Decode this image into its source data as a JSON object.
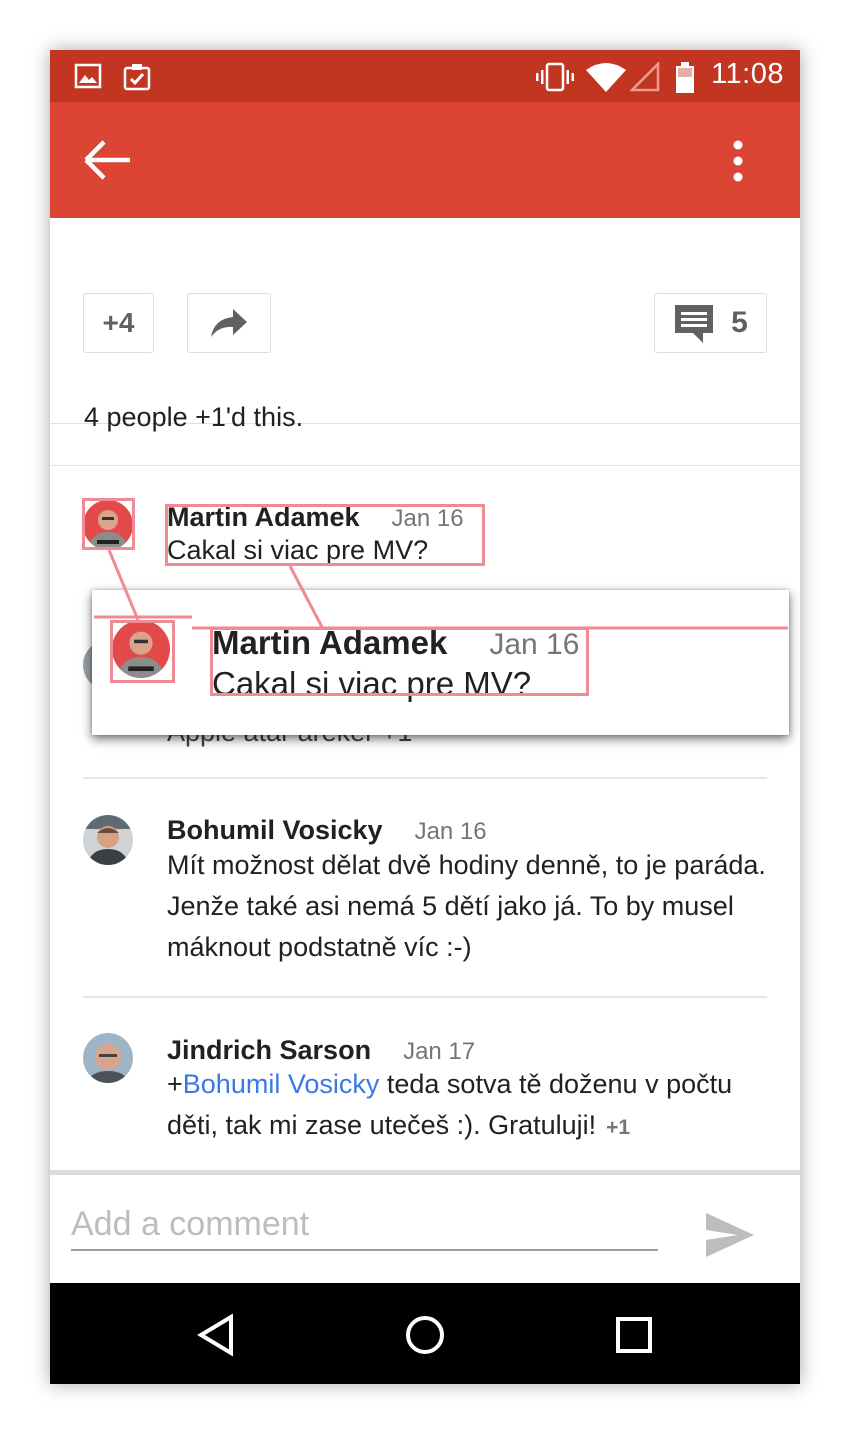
{
  "status_bar": {
    "time": "11:08",
    "icons": [
      "image-icon",
      "clipboard-check-icon",
      "vibrate-icon",
      "wifi-icon",
      "signal-icon",
      "battery-icon"
    ]
  },
  "app_bar": {
    "background": "#dc4533",
    "status_background": "#c23520"
  },
  "actions": {
    "plus_count": "+4",
    "comment_count": "5"
  },
  "plus_summary": "4 people +1'd this.",
  "comments": [
    {
      "author": "Martin Adamek",
      "date": "Jan 16",
      "text": "Cakal si viac pre MV?"
    },
    {
      "author": "Bohumil Vosicky",
      "date": "Jan 16",
      "text": "Mít možnost dělat dvě hodiny denně, to je paráda. Jenže také asi nemá 5 dětí jako já. To by musel máknout podstatně víc :-)"
    },
    {
      "author": "Jindrich Sarson",
      "date": "Jan 17",
      "mention_prefix": "+",
      "mention": "Bohumil Vosicky",
      "text": " teda sotva tě doženu v počtu děti, tak mi zase utečeš :). Gratuluji!",
      "plus_one": "+1"
    }
  ],
  "hidden_comment_fragment": "Apple atar areker +1",
  "zoom_overlay": {
    "author": "Martin Adamek",
    "date": "Jan 16",
    "text": "Cakal si viac pre MV?",
    "highlight_color": "#f08a94"
  },
  "composer": {
    "placeholder": "Add a comment",
    "value": ""
  },
  "accent_colors": {
    "mention": "#3b78e7"
  }
}
